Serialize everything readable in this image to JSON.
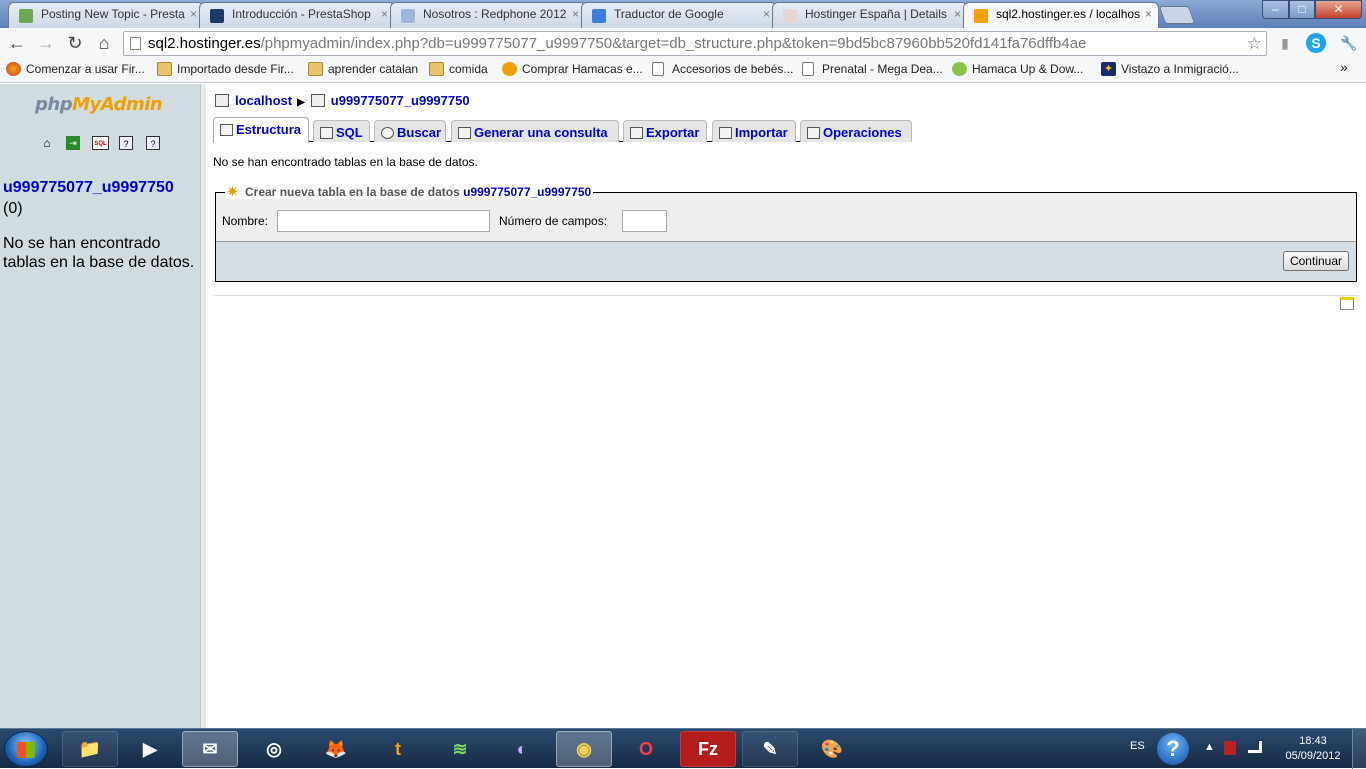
{
  "browser": {
    "tabs": [
      {
        "title": "Posting New Topic - Presta",
        "color": "#6aa84f"
      },
      {
        "title": "Introducción - PrestaShop",
        "color": "#1f3a68"
      },
      {
        "title": "Nosotros : Redphone 2012",
        "color": "#9fb6d9"
      },
      {
        "title": "Traductor de Google",
        "color": "#3b7ddd"
      },
      {
        "title": "Hostinger España | Details",
        "color": "#e6d5d5"
      },
      {
        "title": "sql2.hostinger.es / localhos",
        "color": "#f0a000"
      }
    ],
    "tab_close": "×",
    "window_buttons": {
      "minimize": "–",
      "maximize": "□",
      "close": "✕"
    },
    "nav": {
      "back": "←",
      "forward": "→",
      "reload": "↻",
      "home": "⌂"
    },
    "url": {
      "host": "sql2.hostinger.es",
      "path": "/phpmyadmin/index.php?db=u999775077_u9997750&target=db_structure.php&token=9bd5bc87960bb520fd141fa76dffb4ae"
    },
    "star": "☆",
    "toolbar_icons": {
      "signal": "▮",
      "skype": "S",
      "wrench": "🔧"
    },
    "bookmarks": [
      {
        "label": "Comenzar a usar Fir...",
        "kind": "firefox"
      },
      {
        "label": "Importado desde Fir...",
        "kind": "folder"
      },
      {
        "label": "aprender catalan",
        "kind": "folder"
      },
      {
        "label": "comida",
        "kind": "folder"
      },
      {
        "label": "Comprar Hamacas e...",
        "kind": "orange"
      },
      {
        "label": "Accesorios de bebés...",
        "kind": "page"
      },
      {
        "label": "Prenatal - Mega Dea...",
        "kind": "page"
      },
      {
        "label": "Hamaca Up & Dow...",
        "kind": "green"
      },
      {
        "label": "Vistazo a Inmigració...",
        "kind": "star"
      }
    ],
    "bookmarks_more": "»"
  },
  "pma": {
    "logo_php": "php",
    "logo_myadmin": "MyAdmin",
    "left_icons": {
      "home": "⌂",
      "exit": "⇥",
      "sql": "SQL",
      "docs": "?",
      "help": "?"
    },
    "left_icon_labels": {
      "sql": "SQL"
    },
    "database": "u999775077_u9997750",
    "table_count": "(0)",
    "left_message": "No se han encontrado tablas en la base de datos.",
    "breadcrumb": {
      "server": "localhost",
      "separator": "▶",
      "database": "u999775077_u9997750"
    },
    "tabs": [
      {
        "label": "Estructura"
      },
      {
        "label": "SQL"
      },
      {
        "label": "Buscar"
      },
      {
        "label": "Generar una consulta"
      },
      {
        "label": "Exportar"
      },
      {
        "label": "Importar"
      },
      {
        "label": "Operaciones"
      }
    ],
    "no_tables_message": "No se han encontrado tablas en la base de datos.",
    "create": {
      "legend": "Crear nueva tabla en la base de datos",
      "legend_db": "u999775077_u9997750",
      "name_label": "Nombre:",
      "name_value": "",
      "fields_label": "Número de campos:",
      "fields_value": "",
      "submit": "Continuar"
    }
  },
  "taskbar": {
    "apps": [
      {
        "name": "explorer",
        "glyph": "📁"
      },
      {
        "name": "media",
        "glyph": "▶"
      },
      {
        "name": "mail",
        "glyph": "✉"
      },
      {
        "name": "recorder",
        "glyph": "◎"
      },
      {
        "name": "firefox",
        "glyph": "🦊"
      },
      {
        "name": "tumblr",
        "glyph": "t"
      },
      {
        "name": "spotify",
        "glyph": "≋"
      },
      {
        "name": "torrent",
        "glyph": "◐"
      },
      {
        "name": "chrome",
        "glyph": "◉"
      },
      {
        "name": "opera",
        "glyph": "O"
      },
      {
        "name": "filezilla",
        "glyph": "Fz"
      },
      {
        "name": "notes",
        "glyph": "✎"
      },
      {
        "name": "paint",
        "glyph": "🎨"
      }
    ],
    "language": "ES",
    "help": "?",
    "tray_arrow": "▲",
    "time": "18:43",
    "date": "05/09/2012"
  }
}
